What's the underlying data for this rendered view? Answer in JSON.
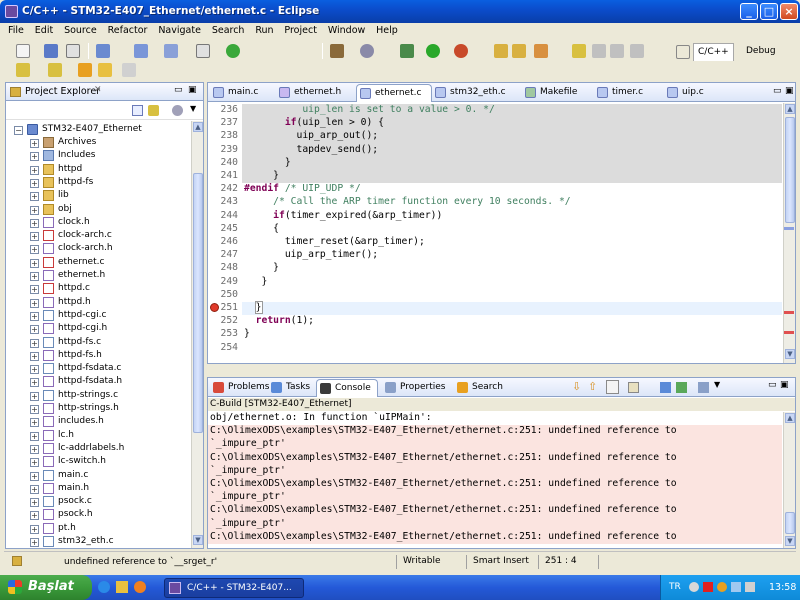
{
  "window": {
    "title": "C/C++ - STM32-E407_Ethernet/ethernet.c - Eclipse"
  },
  "menu": [
    "File",
    "Edit",
    "Source",
    "Refactor",
    "Navigate",
    "Search",
    "Run",
    "Project",
    "Window",
    "Help"
  ],
  "perspectives": {
    "cpp": "C/C++",
    "debug": "Debug"
  },
  "explorer": {
    "title": "Project Explorer",
    "project": "STM32-E407_Ethernet",
    "items": [
      {
        "label": "Archives",
        "kind": "archive"
      },
      {
        "label": "Includes",
        "kind": "include"
      },
      {
        "label": "httpd",
        "kind": "folder"
      },
      {
        "label": "httpd-fs",
        "kind": "folder"
      },
      {
        "label": "lib",
        "kind": "folder"
      },
      {
        "label": "obj",
        "kind": "folder"
      },
      {
        "label": "clock.h",
        "kind": "h"
      },
      {
        "label": "clock-arch.c",
        "kind": "cerr"
      },
      {
        "label": "clock-arch.h",
        "kind": "h"
      },
      {
        "label": "ethernet.c",
        "kind": "cerr"
      },
      {
        "label": "ethernet.h",
        "kind": "h"
      },
      {
        "label": "httpd.c",
        "kind": "cerr"
      },
      {
        "label": "httpd.h",
        "kind": "h"
      },
      {
        "label": "httpd-cgi.c",
        "kind": "c"
      },
      {
        "label": "httpd-cgi.h",
        "kind": "h"
      },
      {
        "label": "httpd-fs.c",
        "kind": "c"
      },
      {
        "label": "httpd-fs.h",
        "kind": "h"
      },
      {
        "label": "httpd-fsdata.c",
        "kind": "c"
      },
      {
        "label": "httpd-fsdata.h",
        "kind": "h"
      },
      {
        "label": "http-strings.c",
        "kind": "c"
      },
      {
        "label": "http-strings.h",
        "kind": "h"
      },
      {
        "label": "includes.h",
        "kind": "h"
      },
      {
        "label": "lc.h",
        "kind": "h"
      },
      {
        "label": "lc-addrlabels.h",
        "kind": "h"
      },
      {
        "label": "lc-switch.h",
        "kind": "h"
      },
      {
        "label": "main.c",
        "kind": "c"
      },
      {
        "label": "main.h",
        "kind": "h"
      },
      {
        "label": "psock.c",
        "kind": "c"
      },
      {
        "label": "psock.h",
        "kind": "h"
      },
      {
        "label": "pt.h",
        "kind": "h"
      },
      {
        "label": "stm32_eth.c",
        "kind": "c"
      }
    ]
  },
  "editor": {
    "tabs": [
      {
        "label": "main.c",
        "active": false
      },
      {
        "label": "ethernet.h",
        "active": false
      },
      {
        "label": "ethernet.c",
        "active": true
      },
      {
        "label": "stm32_eth.c",
        "active": false
      },
      {
        "label": "Makefile",
        "active": false
      },
      {
        "label": "timer.c",
        "active": false
      },
      {
        "label": "uip.c",
        "active": false
      }
    ],
    "lines": [
      {
        "n": "236",
        "text": "          uip_len is set to a value > 0. */",
        "cls": "cm",
        "gray": true
      },
      {
        "n": "237",
        "text": "       if(uip_len > 0) {",
        "cls": "",
        "gray": true
      },
      {
        "n": "238",
        "text": "         uip_arp_out();",
        "cls": "",
        "gray": true
      },
      {
        "n": "239",
        "text": "         tapdev_send();",
        "cls": "",
        "gray": true
      },
      {
        "n": "240",
        "text": "       }",
        "cls": "",
        "gray": true
      },
      {
        "n": "241",
        "text": "     }",
        "cls": "",
        "gray": true
      },
      {
        "n": "242",
        "text": "#endif /* UIP_UDP */",
        "cls": "endif",
        "gray": false
      },
      {
        "n": "243",
        "text": "     /* Call the ARP timer function every 10 seconds. */",
        "cls": "cm",
        "gray": false
      },
      {
        "n": "244",
        "text": "     if(timer_expired(&arp_timer))",
        "cls": "",
        "gray": false
      },
      {
        "n": "245",
        "text": "     {",
        "cls": "",
        "gray": false
      },
      {
        "n": "246",
        "text": "       timer_reset(&arp_timer);",
        "cls": "",
        "gray": false
      },
      {
        "n": "247",
        "text": "       uip_arp_timer();",
        "cls": "",
        "gray": false
      },
      {
        "n": "248",
        "text": "     }",
        "cls": "",
        "gray": false
      },
      {
        "n": "249",
        "text": "   }",
        "cls": "",
        "gray": false
      },
      {
        "n": "250",
        "text": "",
        "cls": "",
        "gray": false
      },
      {
        "n": "251",
        "text": "  }",
        "cls": "cur",
        "gray": false
      },
      {
        "n": "252",
        "text": "  return(1);",
        "cls": "ret",
        "gray": false
      },
      {
        "n": "253",
        "text": "}",
        "cls": "",
        "gray": false
      },
      {
        "n": "254",
        "text": "",
        "cls": "",
        "gray": false
      }
    ]
  },
  "bottom": {
    "tabs": [
      "Problems",
      "Tasks",
      "Console",
      "Properties",
      "Search"
    ],
    "console_title": "C-Build [STM32-E407_Ethernet]",
    "lines": [
      {
        "text": "obj/ethernet.o: In function `uIPMain':",
        "err": false
      },
      {
        "text": "C:\\OlimexODS\\examples\\STM32-E407_Ethernet/ethernet.c:251: undefined reference to",
        "err": true
      },
      {
        "text": "`_impure_ptr'",
        "err": true
      },
      {
        "text": "C:\\OlimexODS\\examples\\STM32-E407_Ethernet/ethernet.c:251: undefined reference to",
        "err": true
      },
      {
        "text": "`_impure_ptr'",
        "err": true
      },
      {
        "text": "C:\\OlimexODS\\examples\\STM32-E407_Ethernet/ethernet.c:251: undefined reference to",
        "err": true
      },
      {
        "text": "`_impure_ptr'",
        "err": true
      },
      {
        "text": "C:\\OlimexODS\\examples\\STM32-E407_Ethernet/ethernet.c:251: undefined reference to",
        "err": true
      },
      {
        "text": "`_impure_ptr'",
        "err": true
      },
      {
        "text": "C:\\OlimexODS\\examples\\STM32-E407_Ethernet/ethernet.c:251: undefined reference to",
        "err": true
      }
    ]
  },
  "status": {
    "message": "undefined reference to `__srget_r'",
    "mode": "Writable",
    "insert": "Smart Insert",
    "pos": "251 : 4"
  },
  "taskbar": {
    "start": "Başlat",
    "task": "C/C++ - STM32-E407...",
    "lang": "TR",
    "time": "13:58"
  }
}
